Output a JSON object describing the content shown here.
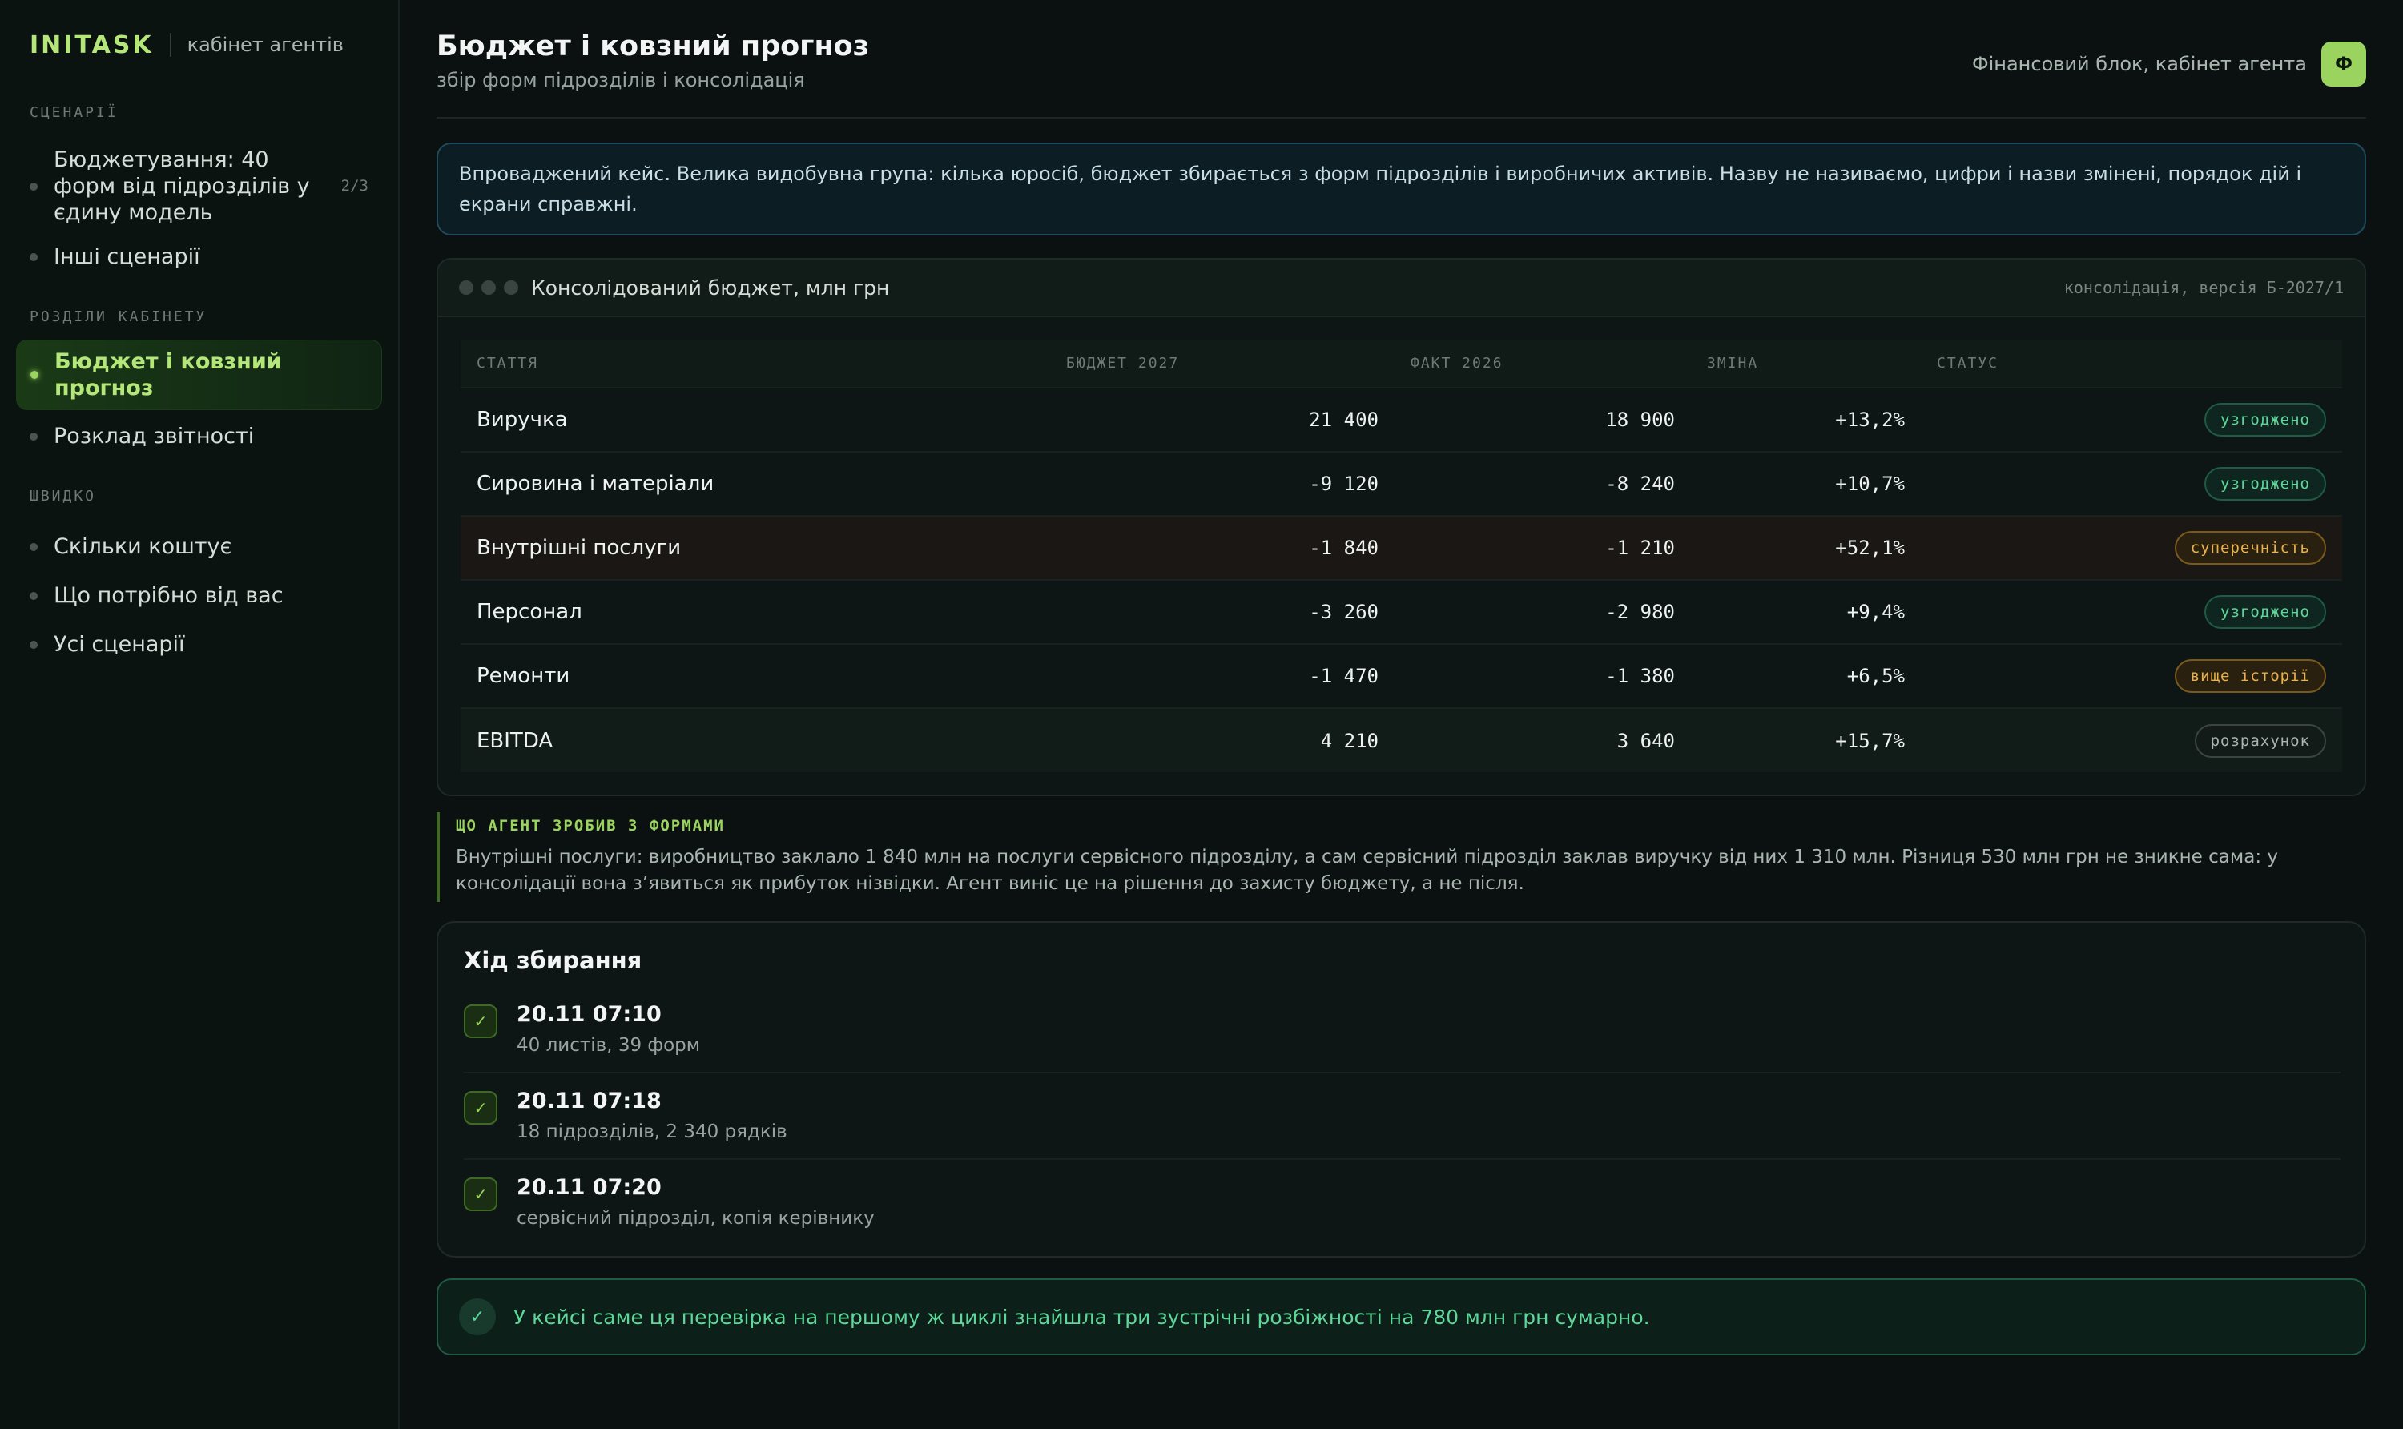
{
  "brand": {
    "logo": "INITASK",
    "subtitle": "кабінет агентів"
  },
  "sidebar": {
    "sections": [
      {
        "title": "СЦЕНАРІЇ",
        "items": [
          {
            "label": "Бюджетування: 40 форм від підрозділів у єдину модель",
            "count": "2/3"
          },
          {
            "label": "Інші сценарії"
          }
        ]
      },
      {
        "title": "РОЗДІЛИ КАБІНЕТУ",
        "items": [
          {
            "label": "Бюджет і ковзний прогноз",
            "active": true
          },
          {
            "label": "Розклад звітності"
          }
        ]
      },
      {
        "title": "ШВИДКО",
        "items": [
          {
            "label": "Скільки коштує"
          },
          {
            "label": "Що потрібно від вас"
          },
          {
            "label": "Усі сценарії"
          }
        ]
      }
    ]
  },
  "header": {
    "title": "Бюджет і ковзний прогноз",
    "subtitle": "збір форм підрозділів і консолідація",
    "user": "Фінансовий блок, кабінет агента",
    "avatar": "Ф"
  },
  "info_banner": "Впроваджений кейс. Велика видобувна група: кілька юросіб, бюджет збирається з форм підрозділів і виробничих активів. Назву не називаємо, цифри і назви змінені, порядок дій і екрани справжні.",
  "budget_card": {
    "title": "Консолідований бюджет, млн грн",
    "meta": "консолідація, версія Б-2027/1",
    "columns": [
      "СТАТТЯ",
      "БЮДЖЕТ 2027",
      "ФАКТ 2026",
      "ЗМІНА",
      "СТАТУС"
    ],
    "rows": [
      {
        "item": "Виручка",
        "budget": "21 400",
        "fact": "18 900",
        "change": "+13,2%",
        "status": "узгоджено",
        "kind": "ok"
      },
      {
        "item": "Сировина і матеріали",
        "budget": "-9 120",
        "fact": "-8 240",
        "change": "+10,7%",
        "status": "узгоджено",
        "kind": "ok"
      },
      {
        "item": "Внутрішні послуги",
        "budget": "-1 840",
        "fact": "-1 210",
        "change": "+52,1%",
        "status": "суперечність",
        "kind": "conflict"
      },
      {
        "item": "Персонал",
        "budget": "-3 260",
        "fact": "-2 980",
        "change": "+9,4%",
        "status": "узгоджено",
        "kind": "ok"
      },
      {
        "item": "Ремонти",
        "budget": "-1 470",
        "fact": "-1 380",
        "change": "+6,5%",
        "status": "вище історії",
        "kind": "warn"
      },
      {
        "item": "EBITDA",
        "budget": "4 210",
        "fact": "3 640",
        "change": "+15,7%",
        "status": "розрахунок",
        "kind": "calc"
      }
    ]
  },
  "note": {
    "title": "ЩО АГЕНТ ЗРОБИВ З ФОРМАМИ",
    "text": "Внутрішні послуги: виробництво заклало 1 840 млн на послуги сервісного підрозділу, а сам сервісний підрозділ заклав виручку від них 1 310 млн. Різниця 530 млн грн не зникне сама: у консолідації вона з’явиться як прибуток нізвідки. Агент виніс це на рішення до захисту бюджету, а не після."
  },
  "progress": {
    "title": "Хід збирання",
    "steps": [
      {
        "time": "20.11 07:10",
        "desc": "40 листів, 39 форм"
      },
      {
        "time": "20.11 07:18",
        "desc": "18 підрозділів, 2 340 рядків"
      },
      {
        "time": "20.11 07:20",
        "desc": "сервісний підрозділ, копія керівнику"
      }
    ]
  },
  "success_banner": "У кейсі саме ця перевірка на першому ж циклі знайшла три зустрічні розбіжності на 780 млн грн сумарно.",
  "colors": {
    "accent": "#9ad45f",
    "ok": "#5fd69a",
    "warn": "#e9b24a",
    "info": "#1f4a5c"
  }
}
